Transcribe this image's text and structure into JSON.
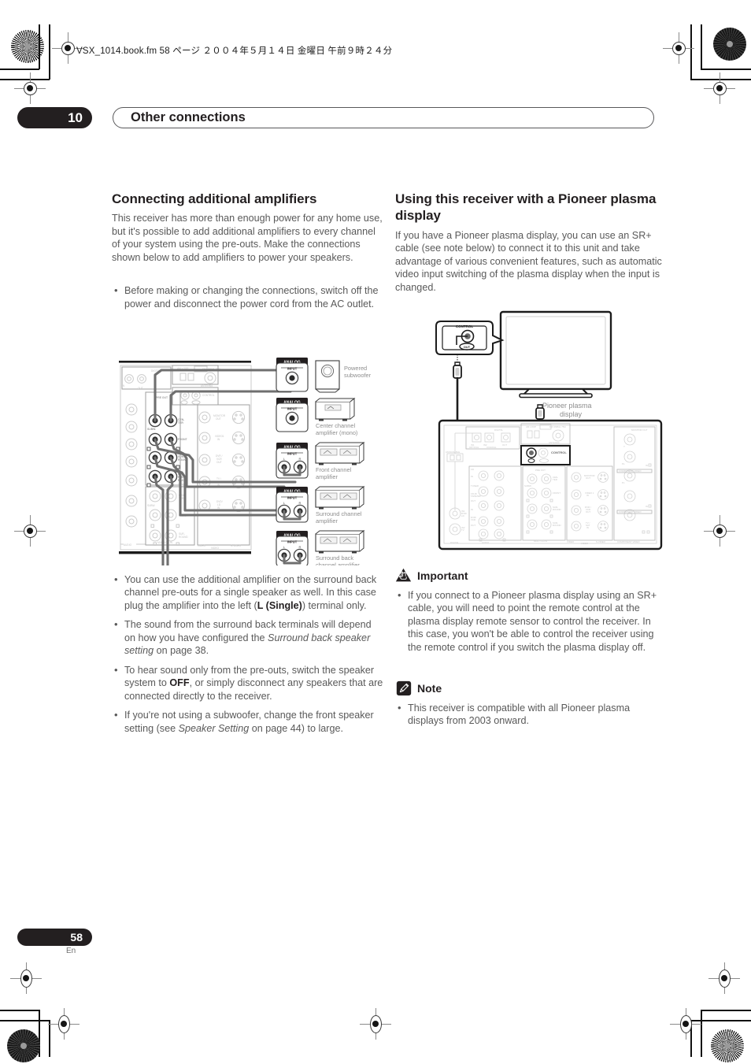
{
  "page": {
    "filestamp": "VSX_1014.book.fm  58 ページ  ２００４年５月１４日   金曜日   午前９時２４分",
    "chapter_number": "10",
    "chapter_title": "Other connections",
    "page_number": "58",
    "language_code": "En"
  },
  "left_column": {
    "heading": "Connecting additional amplifiers",
    "intro": "This receiver has more than enough power for any home use, but it's possible to add additional amplifiers to every channel of your system using the pre-outs. Make the connections shown below to add amplifiers to power your speakers.",
    "top_bullets": [
      "Before making or changing the connections, switch off the power and disconnect the power cord from the AC outlet."
    ],
    "bottom_bullets": [
      {
        "parts": [
          {
            "text": "You can use the additional amplifier on the surround back channel pre-outs for a single speaker as well. In this case plug the amplifier into the left (",
            "style": "normal"
          },
          {
            "text": "L (Single)",
            "style": "bold"
          },
          {
            "text": ") terminal only.",
            "style": "normal"
          }
        ]
      },
      {
        "parts": [
          {
            "text": "The sound from the surround back terminals will depend on how you have configured the ",
            "style": "normal"
          },
          {
            "text": "Surround back speaker setting",
            "style": "italic"
          },
          {
            "text": " on page 38.",
            "style": "normal"
          }
        ]
      },
      {
        "parts": [
          {
            "text": "To hear sound only from the pre-outs, switch the speaker system to ",
            "style": "normal"
          },
          {
            "text": "OFF",
            "style": "bold"
          },
          {
            "text": ", or simply disconnect any speakers that are connected directly to the receiver.",
            "style": "normal"
          }
        ]
      },
      {
        "parts": [
          {
            "text": "If you're not using a subwoofer, change the front speaker setting (see ",
            "style": "normal"
          },
          {
            "text": "Speaker Setting",
            "style": "italic"
          },
          {
            "text": " on page 44) to large.",
            "style": "normal"
          }
        ]
      }
    ],
    "diagram": {
      "name": "amplifier-preout-connection-diagram",
      "panel_labels": [
        "DIGITAL",
        "AM LOOP",
        "FM UNBAL 75Ω",
        "ANTENNA",
        "OUT",
        "PRE OUT",
        "CONTROL",
        "SUBW.",
        "CENTER",
        "FRONT",
        "SUR-ROUND",
        "SUR-ROUND BACK",
        "(Single)",
        "MONITOR OUT",
        "VIDEO1 IN",
        "DVR / VCR OUT",
        "TV / SAT IN",
        "DVD/ LD IN",
        "MULTI CH IN",
        "AUDIO",
        "VIDEO",
        "S-VIDEO"
      ],
      "devices": [
        {
          "jack_label": "ANALOG",
          "jack_sub": "INPUT",
          "jacks": [
            "mono"
          ],
          "caption": "Powered subwoofer",
          "type": "subwoofer"
        },
        {
          "jack_label": "ANALOG",
          "jack_sub": "INPUT",
          "jacks": [
            "mono"
          ],
          "caption": "Center channel amplifier (mono)",
          "type": "amp-1ch"
        },
        {
          "jack_label": "ANALOG",
          "jack_sub": "INPUT",
          "jacks": [
            "L",
            "R"
          ],
          "caption": "Front channel amplifier",
          "type": "amp-2ch"
        },
        {
          "jack_label": "ANALOG",
          "jack_sub": "INPUT",
          "jacks": [
            "L",
            "R"
          ],
          "caption": "Surround channel amplifier",
          "type": "amp-2ch"
        },
        {
          "jack_label": "ANALOG",
          "jack_sub": "INPUT",
          "jacks": [
            "L",
            "R"
          ],
          "caption": "Surround back channel amplifier",
          "type": "amp-2ch"
        }
      ]
    }
  },
  "right_column": {
    "heading": "Using this receiver with a Pioneer plasma display",
    "intro": "If you have a Pioneer plasma display, you can use an SR+ cable (see note below) to connect it to this unit and take advantage of various convenient features, such as automatic video input switching of the plasma display when the input is changed.",
    "diagram": {
      "name": "plasma-display-connection-diagram",
      "callout_label": "CONTROL",
      "callout_port": "OUT",
      "display_caption": "Pioneer plasma display",
      "panel_labels": [
        "DIGITAL",
        "AM LOOP",
        "FM UNBAL 75Ω",
        "PRE OUT",
        "CONTROL",
        "MONITOR OUT",
        "MULTI CH IN",
        "COMPONENT VIDEO",
        "VIDEO",
        "S-VIDEO",
        "AUDIO",
        "OUT",
        "IN"
      ]
    },
    "important": {
      "icon": "warning-icon",
      "title": "Important",
      "bullets": [
        "If you connect to a Pioneer plasma display using an SR+ cable, you will need to point the remote control at the plasma display remote sensor to control the receiver. In this case, you won't be able to control the receiver using the remote control if you switch the plasma display off."
      ]
    },
    "note": {
      "icon": "pencil-icon",
      "title": "Note",
      "bullets": [
        "This receiver is compatible with all Pioneer plasma displays from 2003 onward."
      ]
    }
  },
  "colors": {
    "ink": "#231f20",
    "body_text": "#595959",
    "rule": "#58585a",
    "cable": "#6d6d6d"
  }
}
